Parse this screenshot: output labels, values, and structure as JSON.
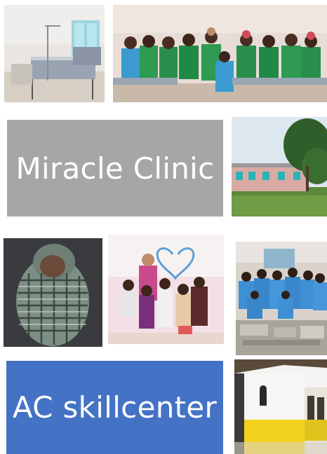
{
  "collage": {
    "label_clinic": "Miracle Clinic",
    "label_skillcenter": "AC skillcenter",
    "colors": {
      "clinic_box": "#a6a6a6",
      "skillcenter_box": "#4472c4",
      "label_text": "#ffffff"
    },
    "photos": [
      {
        "name": "hospital-beds-photo"
      },
      {
        "name": "children-group-green-uniforms-photo"
      },
      {
        "name": "clinic-building-photo"
      },
      {
        "name": "newborn-baby-photo"
      },
      {
        "name": "woman-with-children-photo"
      },
      {
        "name": "children-blue-uniforms-photo"
      },
      {
        "name": "skillcenter-building-photo"
      }
    ]
  }
}
